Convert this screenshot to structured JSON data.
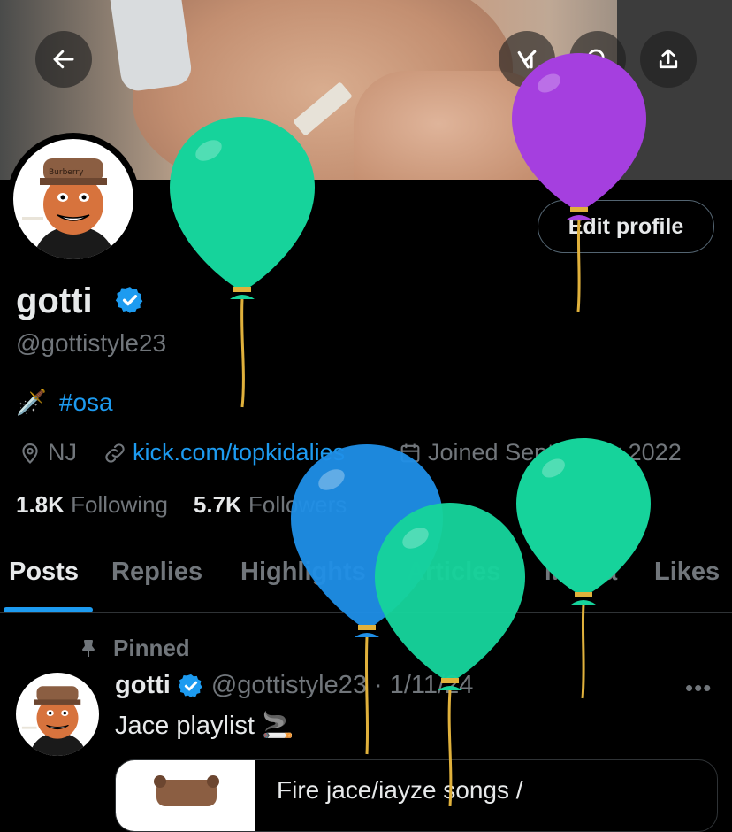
{
  "header": {
    "back_icon": "arrow-left-icon",
    "grok_icon": "grok-icon",
    "search_icon": "search-icon",
    "share_icon": "share-icon"
  },
  "profile": {
    "edit_label": "Edit profile",
    "name": "gotti",
    "handle": "@gottistyle23",
    "bio_emoji": "🗡️",
    "bio_hashtag": "#osa",
    "location": "NJ",
    "website": "kick.com/topkidalies",
    "joined": "Joined September 2022",
    "following_count": "1.8K",
    "following_label": "Following",
    "followers_count": "5.7K",
    "followers_label": "Followers",
    "avatar_cap_text": "Burberry"
  },
  "tabs": [
    {
      "label": "Posts"
    },
    {
      "label": "Replies"
    },
    {
      "label": "Highlights"
    },
    {
      "label": "Articles"
    },
    {
      "label": "Media"
    },
    {
      "label": "Likes"
    }
  ],
  "post": {
    "pinned_label": "Pinned",
    "name": "gotti",
    "handle_date": "@gottistyle23 · 1/11/24",
    "text": "Jace playlist 🚬",
    "more": "•••",
    "card_title": "Fire jace/iayze songs /"
  },
  "colors": {
    "accent": "#1d9bf0",
    "muted": "#71767b",
    "balloon_green": "#19d9a0",
    "balloon_purple": "#a63fe0",
    "balloon_blue": "#1f8fe8"
  }
}
